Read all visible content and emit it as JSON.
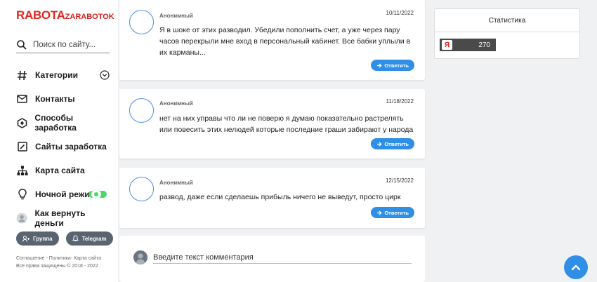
{
  "logo": {
    "part1": "RABOTA",
    "part2": "ZARABOTOK"
  },
  "search": {
    "placeholder": "Поиск по сайту..."
  },
  "nav": {
    "items": [
      {
        "label": "Категории",
        "icon": "hash-icon"
      },
      {
        "label": "Контакты",
        "icon": "mail-icon"
      },
      {
        "label": "Способы заработка",
        "icon": "hexagon-icon"
      },
      {
        "label": "Сайты заработка",
        "icon": "edit-icon"
      },
      {
        "label": "Карта сайта",
        "icon": "sitemap-icon"
      },
      {
        "label": "Ночной режим",
        "icon": "bulb-icon"
      },
      {
        "label": "Как вернуть деньги",
        "icon": "user-icon"
      }
    ]
  },
  "social": {
    "group": "Группа",
    "telegram": "Telegram"
  },
  "footer": {
    "line1": "Соглашение - Политика- Карта сайта",
    "line2": "Все права защищены © 2018 - 2022"
  },
  "comments": [
    {
      "author": "Анонимный",
      "date": "10/11/2022",
      "text": "Я в шоке от этих разводил. Убедили пополнить счет, а уже через пару часов перекрыли мне вход в персональный кабинет. Все бабки уплыли в их карманы...",
      "reply": "Ответить"
    },
    {
      "author": "Анонимный",
      "date": "11/18/2022",
      "text": "нет на них управы что ли не поверю я думаю показательно растрелять или повесить этих нелюдей которые последние граши забирают у народа",
      "reply": "Ответить"
    },
    {
      "author": "Анонимный",
      "date": "12/15/2022",
      "text": "развод, даже если сделаешь прибыль ничего не выведут, просто цирк",
      "reply": "Ответить"
    }
  ],
  "comment_form": {
    "placeholder": "Введите текст комментария"
  },
  "stats": {
    "title": "Статистика",
    "counter_logo": "Я",
    "counter_value": "270"
  },
  "colors": {
    "accent": "#2f8fe6",
    "brand": "#e52521",
    "toggle": "#4fd46b"
  }
}
